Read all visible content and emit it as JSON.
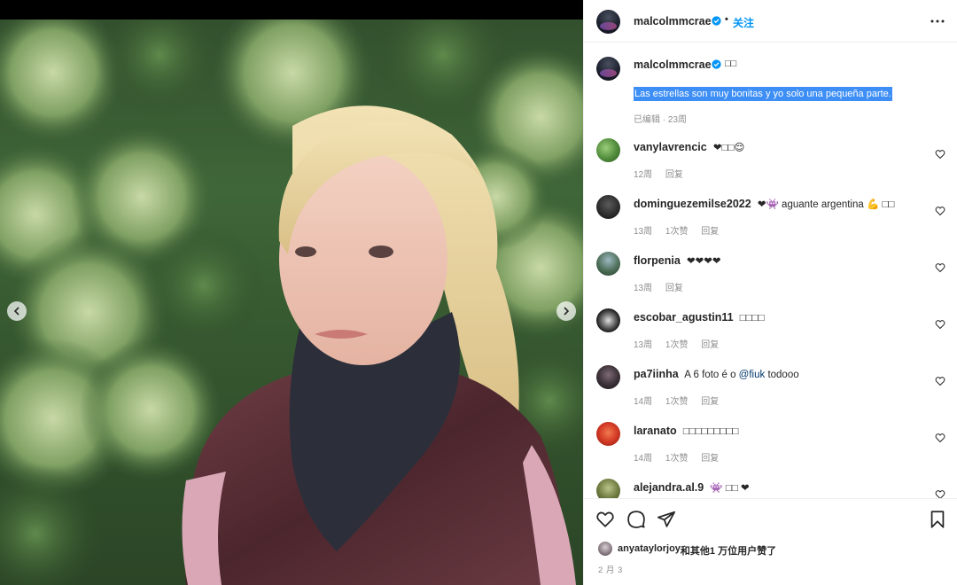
{
  "post": {
    "author": "malcolmmcrae",
    "follow_label": "关注",
    "dot": "•",
    "more_icon": "more-horizontal-icon"
  },
  "caption": {
    "username": "malcolmmcrae",
    "emoji": "□□",
    "text": "Las estrellas son muy bonitas y yo solo una pequeña parte.",
    "meta": "已编辑 · 23周"
  },
  "comments": [
    {
      "username": "vanylavrencic",
      "text": "❤︎□□😌",
      "time": "12周",
      "likes": "",
      "reply": "回复"
    },
    {
      "username": "dominguezemilse2022",
      "text": "❤︎👾 aguante argentina 💪 □□",
      "time": "13周",
      "likes": "1次赞",
      "reply": "回复"
    },
    {
      "username": "florpenia",
      "text": "❤︎❤︎❤︎❤︎",
      "time": "13周",
      "likes": "",
      "reply": "回复"
    },
    {
      "username": "escobar_agustin11",
      "text": "□□□□",
      "time": "13周",
      "likes": "1次赞",
      "reply": "回复"
    },
    {
      "username": "pa7iinha",
      "text_before": "A 6 foto é o ",
      "mention": "@fiuk",
      "text_after": " todooo",
      "time": "14周",
      "likes": "1次赞",
      "reply": "回复"
    },
    {
      "username": "laranato",
      "text": "□□□□□□□□□",
      "time": "14周",
      "likes": "1次赞",
      "reply": "回复"
    },
    {
      "username": "alejandra.al.9",
      "text": "👾 □□ ❤︎",
      "time": "",
      "likes": "",
      "reply": ""
    }
  ],
  "actions": {
    "like_icon": "heart-icon",
    "comment_icon": "comment-icon",
    "share_icon": "send-icon",
    "save_icon": "bookmark-icon"
  },
  "likes": {
    "user": "anyataylorjoy",
    "text": "和其他1 万位用户赞了"
  },
  "date": "2 月 3",
  "colors": {
    "accent": "#0095f6",
    "caption_highlight": "#3d8ef5",
    "muted": "#8e8e8e",
    "text": "#262626",
    "mention": "#00376b"
  }
}
